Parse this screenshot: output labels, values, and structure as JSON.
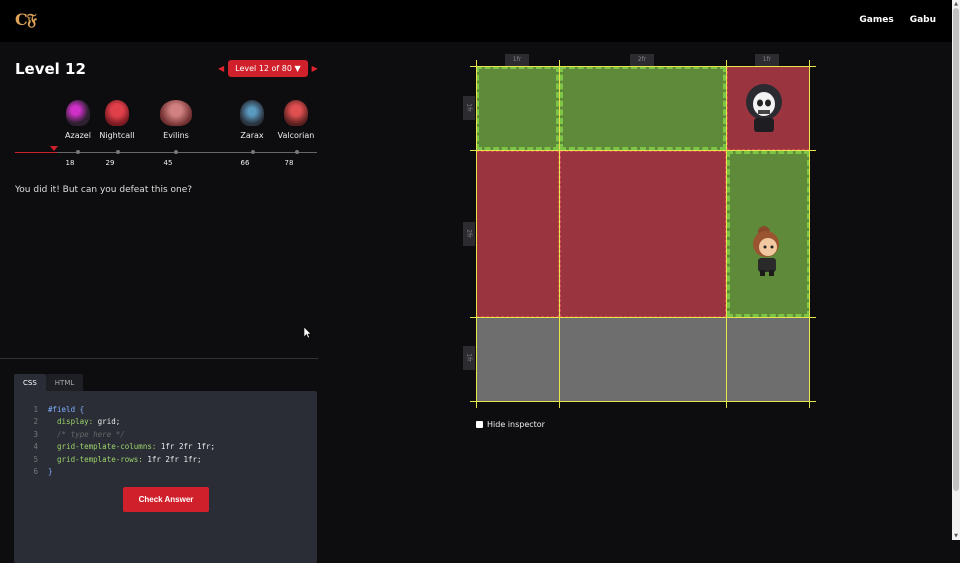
{
  "app": {
    "logo": "C𝔉"
  },
  "nav": {
    "games": "Games",
    "user": "Gabu"
  },
  "level": {
    "title": "Level 12",
    "selector": "Level 12 of 80 ▼"
  },
  "bosses": [
    {
      "name": "Azazel",
      "level": "18",
      "color": "#6b3a78"
    },
    {
      "name": "Nightcall",
      "level": "29",
      "color": "#b0303a"
    },
    {
      "name": "Evilins",
      "level": "45",
      "color": "#a04848"
    },
    {
      "name": "Zarax",
      "level": "66",
      "color": "#3a4858"
    },
    {
      "name": "Valcorian",
      "level": "78",
      "color": "#a33c3c"
    }
  ],
  "message": "You did it! But can you defeat this one?",
  "editor": {
    "tabs": [
      "CSS",
      "HTML"
    ],
    "line_numbers": [
      "1",
      "2",
      "3",
      "4",
      "5",
      "6"
    ],
    "selector": "#field {",
    "display_prop": "display:",
    "display_val": " grid;",
    "comment": "/* type here */",
    "cols_prop": "grid-template-columns:",
    "cols_val": " 1fr 2fr 1fr;",
    "rows_prop": "grid-template-rows:",
    "rows_val": " 1fr 2fr 1fr;",
    "close": "}",
    "check_label": "Check Answer"
  },
  "inspector": {
    "col_labels": [
      "1fr",
      "2fr",
      "1fr"
    ],
    "row_labels": [
      "1fr",
      "2fr",
      "1fr"
    ],
    "hide_label": "Hide inspector",
    "colors": {
      "green": "#5f8a3a",
      "red": "#9a3540",
      "grey": "#6e6e6e",
      "line": "#e6e64a"
    }
  }
}
